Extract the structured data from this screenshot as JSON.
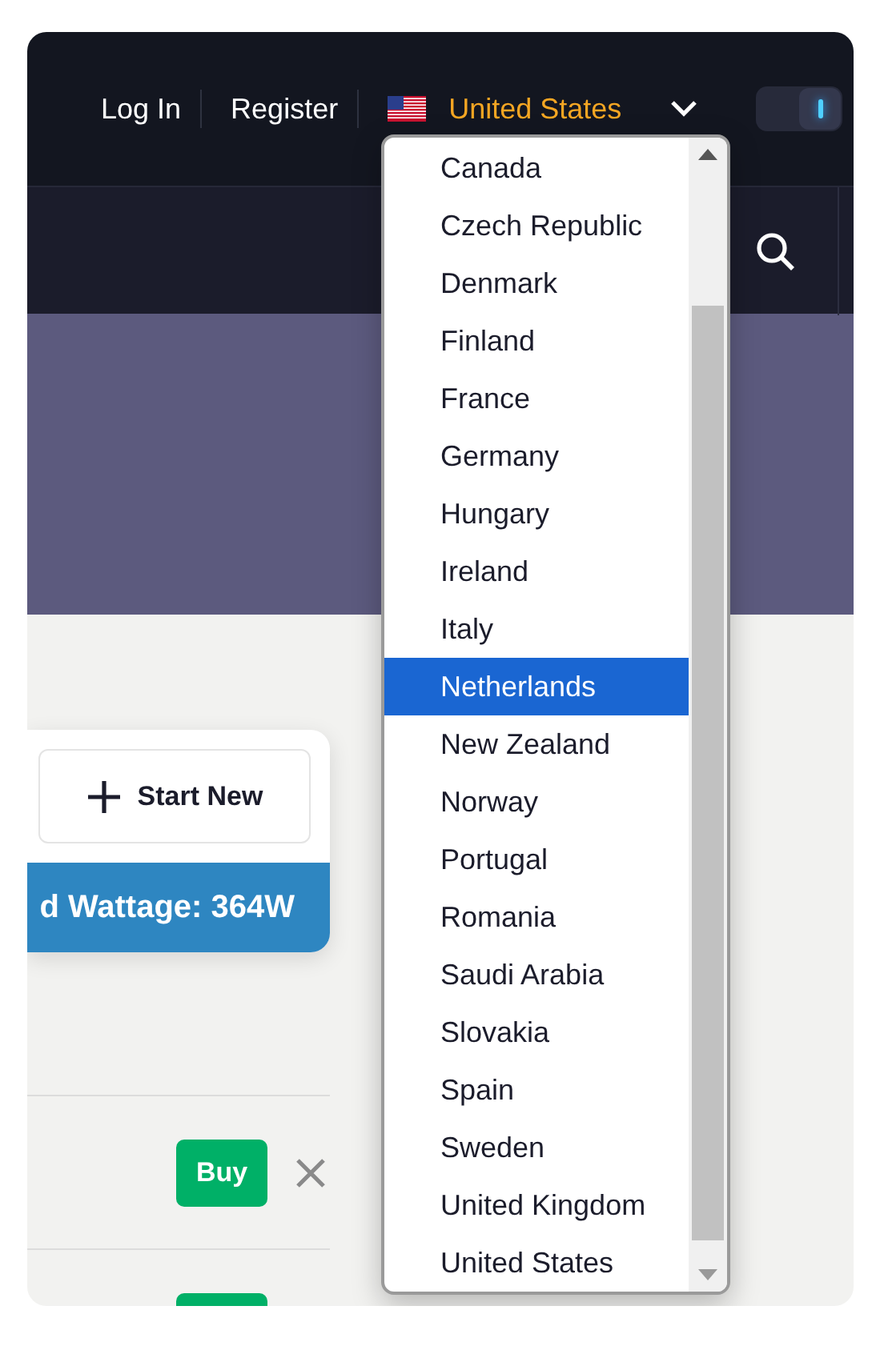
{
  "top_bar": {
    "links": [
      {
        "label": "Log In"
      },
      {
        "label": "Register"
      }
    ],
    "country": {
      "label": "United States",
      "expanded": true
    },
    "toggle": {
      "on": true
    }
  },
  "country_menu": {
    "options": [
      {
        "label": "Canada",
        "selected": false
      },
      {
        "label": "Czech Republic",
        "selected": false
      },
      {
        "label": "Denmark",
        "selected": false
      },
      {
        "label": "Finland",
        "selected": false
      },
      {
        "label": "France",
        "selected": false
      },
      {
        "label": "Germany",
        "selected": false
      },
      {
        "label": "Hungary",
        "selected": false
      },
      {
        "label": "Ireland",
        "selected": false
      },
      {
        "label": "Italy",
        "selected": false
      },
      {
        "label": "Netherlands",
        "selected": true
      },
      {
        "label": "New Zealand",
        "selected": false
      },
      {
        "label": "Norway",
        "selected": false
      },
      {
        "label": "Portugal",
        "selected": false
      },
      {
        "label": "Romania",
        "selected": false
      },
      {
        "label": "Saudi Arabia",
        "selected": false
      },
      {
        "label": "Slovakia",
        "selected": false
      },
      {
        "label": "Spain",
        "selected": false
      },
      {
        "label": "Sweden",
        "selected": false
      },
      {
        "label": "United Kingdom",
        "selected": false
      },
      {
        "label": "United States",
        "selected": false
      }
    ]
  },
  "card": {
    "button": "Start New",
    "wattage": "d Wattage: 364W"
  },
  "rows": [
    {
      "kind": "full",
      "button": "Buy"
    },
    {
      "kind": "cut"
    }
  ]
}
